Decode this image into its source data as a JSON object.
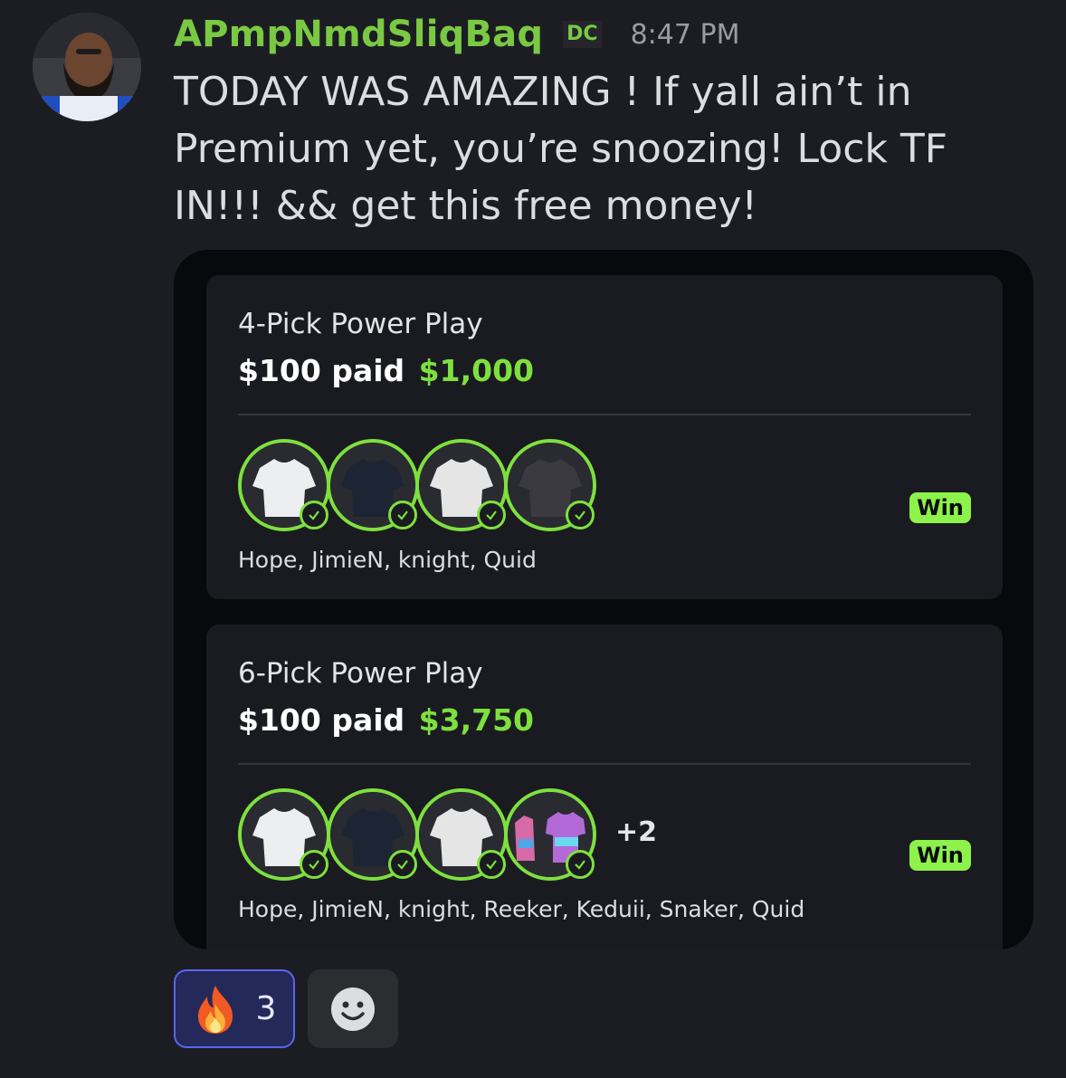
{
  "message": {
    "author": "APmpNmdSliqBaq",
    "tag": "DC",
    "timestamp": "8:47 PM",
    "text": "TODAY WAS AMAZING ! If yall ain’t in Premium yet, you’re snoozing! Lock TF IN!!! && get this free money!"
  },
  "cards": [
    {
      "title": "4-Pick Power Play",
      "paid_label": "$100 paid",
      "won_amount": "$1,000",
      "players": "Hope, JimieN, knight, Quid",
      "status": "Win",
      "extra": ""
    },
    {
      "title": "6-Pick Power Play",
      "paid_label": "$100 paid",
      "won_amount": "$3,750",
      "players": "Hope, JimieN, knight, Reeker, Keduii, Snaker, Quid",
      "status": "Win",
      "extra": "+2"
    }
  ],
  "reactions": [
    {
      "emoji": "fire-emoji",
      "count": "3",
      "active": true
    }
  ],
  "colors": {
    "author": "#7ac943",
    "won": "#7ee03e",
    "win_badge": "#8df24a",
    "reaction_active_border": "#5865f2"
  }
}
